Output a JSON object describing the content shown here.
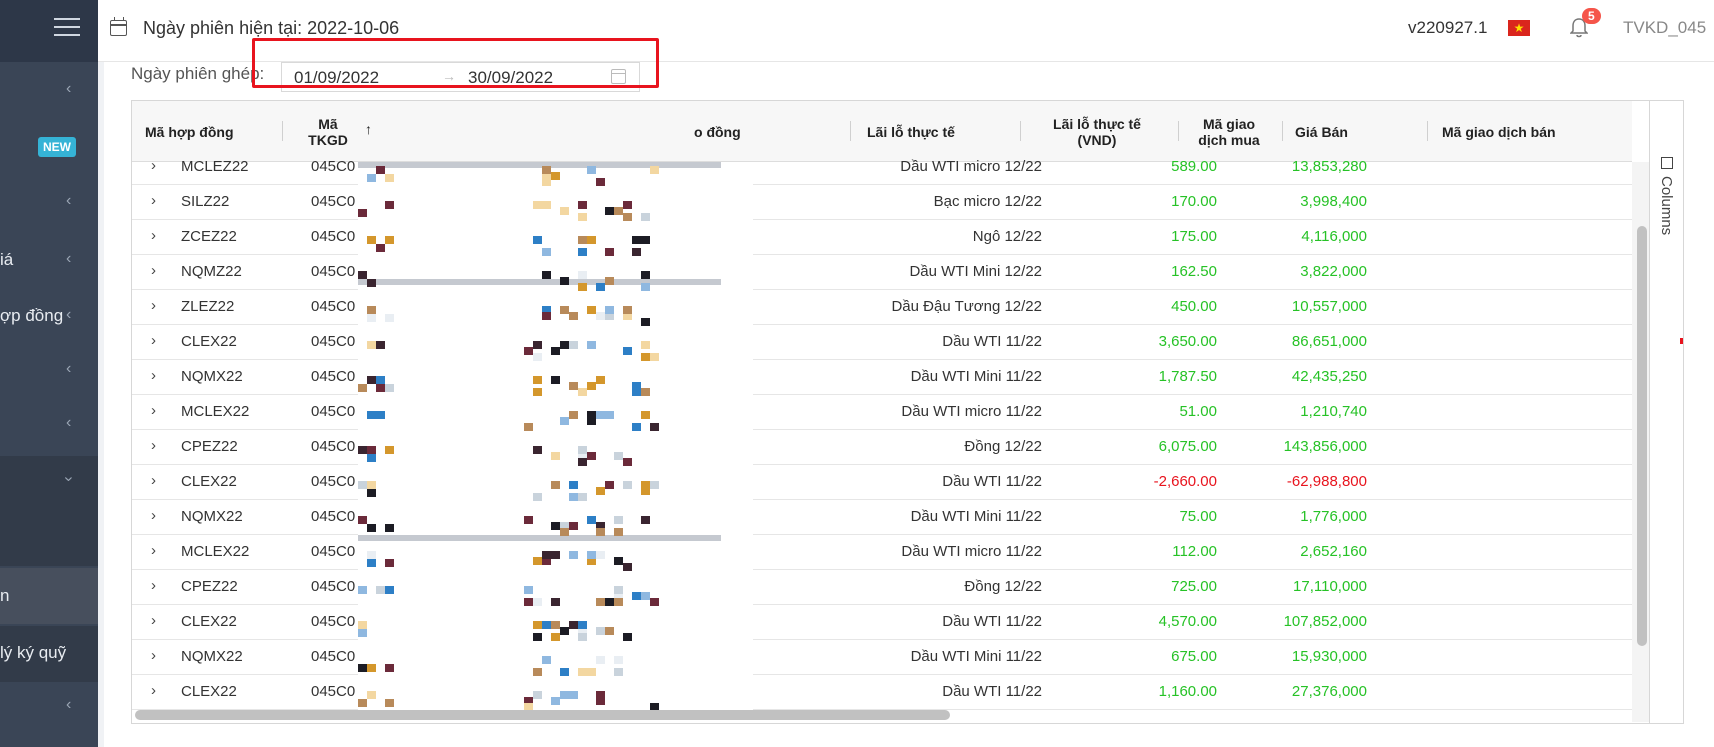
{
  "header": {
    "session_date": "Ngày phiên hiện tại: 2022-10-06",
    "version": "v220927.1",
    "notification_count": "5",
    "user": "TVKD_045",
    "flag": "★"
  },
  "sidebar": {
    "logo": "I",
    "new_badge": "NEW",
    "items": [
      {
        "label": "iá"
      },
      {
        "label": "ợp đồng"
      },
      {
        "label": "n"
      },
      {
        "label": "lý ký quỹ"
      }
    ]
  },
  "filter": {
    "label": "Ngày phiên ghép:",
    "start": "01/09/2022",
    "separator": "→",
    "end": "30/09/2022"
  },
  "table": {
    "columns": {
      "contract_code": "Mã hợp đồng",
      "account_line1": "Mã",
      "account_line2": "TKGD",
      "contract_name": "o đồng",
      "pl": "Lãi lỗ thực tế",
      "pl_vnd_line1": "Lãi lỗ thực tế",
      "pl_vnd_line2": "(VND)",
      "buy_code_line1": "Mã giao",
      "buy_code_line2": "dịch mua",
      "sell_price": "Giá Bán",
      "sell_code": "Mã giao dịch bán"
    },
    "columns_panel": "Columns",
    "rows": [
      {
        "code": "MCLEZ22",
        "account": "045C0",
        "name": "Dầu WTI micro 12/22",
        "pl": "589.00",
        "pl_vnd": "13,853,280",
        "negative": false
      },
      {
        "code": "SILZ22",
        "account": "045C0",
        "name": "Bạc micro 12/22",
        "pl": "170.00",
        "pl_vnd": "3,998,400",
        "negative": false
      },
      {
        "code": "ZCEZ22",
        "account": "045C0",
        "name": "Ngô 12/22",
        "pl": "175.00",
        "pl_vnd": "4,116,000",
        "negative": false
      },
      {
        "code": "NQMZ22",
        "account": "045C0",
        "name": "Dầu WTI Mini 12/22",
        "pl": "162.50",
        "pl_vnd": "3,822,000",
        "negative": false
      },
      {
        "code": "ZLEZ22",
        "account": "045C0",
        "name": "Dầu Đậu Tương 12/22",
        "pl": "450.00",
        "pl_vnd": "10,557,000",
        "negative": false
      },
      {
        "code": "CLEX22",
        "account": "045C0",
        "name": "Dầu WTI 11/22",
        "pl": "3,650.00",
        "pl_vnd": "86,651,000",
        "negative": false
      },
      {
        "code": "NQMX22",
        "account": "045C0",
        "name": "Dầu WTI Mini 11/22",
        "pl": "1,787.50",
        "pl_vnd": "42,435,250",
        "negative": false
      },
      {
        "code": "MCLEX22",
        "account": "045C0",
        "name": "Dầu WTI micro 11/22",
        "pl": "51.00",
        "pl_vnd": "1,210,740",
        "negative": false
      },
      {
        "code": "CPEZ22",
        "account": "045C0",
        "name": "Đồng 12/22",
        "pl": "6,075.00",
        "pl_vnd": "143,856,000",
        "negative": false
      },
      {
        "code": "CLEX22",
        "account": "045C0",
        "name": "Dầu WTI 11/22",
        "pl": "-2,660.00",
        "pl_vnd": "-62,988,800",
        "negative": true
      },
      {
        "code": "NQMX22",
        "account": "045C0",
        "name": "Dầu WTI Mini 11/22",
        "pl": "75.00",
        "pl_vnd": "1,776,000",
        "negative": false
      },
      {
        "code": "MCLEX22",
        "account": "045C0",
        "name": "Dầu WTI micro 11/22",
        "pl": "112.00",
        "pl_vnd": "2,652,160",
        "negative": false
      },
      {
        "code": "CPEZ22",
        "account": "045C0",
        "name": "Đồng 12/22",
        "pl": "725.00",
        "pl_vnd": "17,110,000",
        "negative": false
      },
      {
        "code": "CLEX22",
        "account": "045C0",
        "name": "Dầu WTI 11/22",
        "pl": "4,570.00",
        "pl_vnd": "107,852,000",
        "negative": false
      },
      {
        "code": "NQMX22",
        "account": "045C0",
        "name": "Dầu WTI Mini 11/22",
        "pl": "675.00",
        "pl_vnd": "15,930,000",
        "negative": false
      },
      {
        "code": "CLEX22",
        "account": "045C0",
        "name": "Dầu WTI 11/22",
        "pl": "1,160.00",
        "pl_vnd": "27,376,000",
        "negative": false
      }
    ]
  },
  "colors": {
    "positive": "#26c226",
    "negative": "#e8141e",
    "sidebar": "#3a4556",
    "highlight": "#e8141e"
  }
}
